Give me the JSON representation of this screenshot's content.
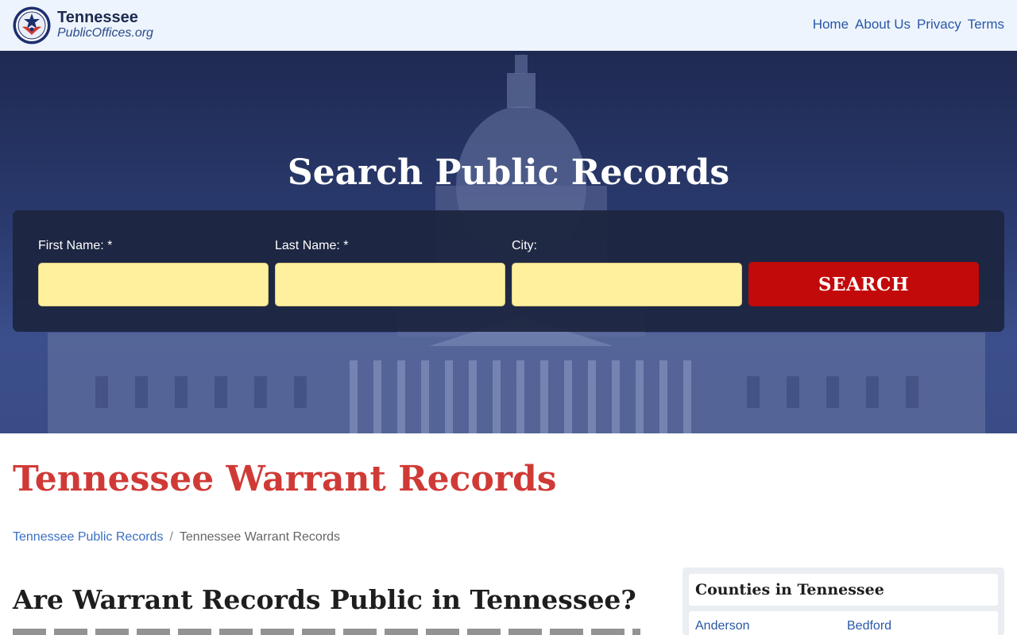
{
  "header": {
    "brand_state": "Tennessee",
    "brand_site": "PublicOffices.org",
    "nav": [
      "Home",
      "About Us",
      "Privacy",
      "Terms"
    ]
  },
  "hero": {
    "title": "Search Public Records",
    "fields": [
      {
        "label": "First Name: *",
        "value": ""
      },
      {
        "label": "Last Name: *",
        "value": ""
      },
      {
        "label": "City:",
        "value": ""
      }
    ],
    "search_label": "SEARCH"
  },
  "main": {
    "page_title": "Tennessee Warrant Records",
    "breadcrumb": {
      "link": "Tennessee Public Records",
      "separator": "/",
      "current": "Tennessee Warrant Records"
    },
    "section_title": "Are Warrant Records Public in Tennessee?"
  },
  "sidebar": {
    "title": "Counties in Tennessee",
    "counties": [
      "Anderson",
      "Bedford"
    ]
  },
  "colors": {
    "accent_red": "#d03a36",
    "button_red": "#c30a0a",
    "link_blue": "#2a57a5",
    "input_yellow": "#fff09e",
    "header_bg": "#edf4fd"
  }
}
